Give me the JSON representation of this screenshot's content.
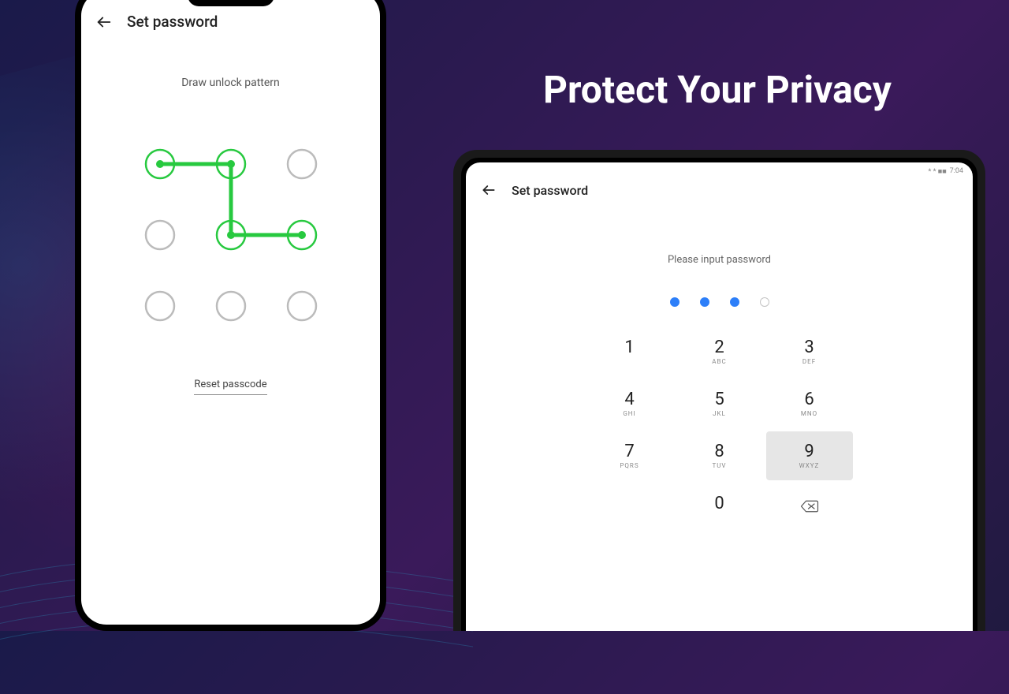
{
  "headline": "Protect Your Privacy",
  "phone": {
    "header": {
      "title": "Set password"
    },
    "prompt": "Draw  unlock  pattern",
    "reset_label": "Reset passcode",
    "pattern": {
      "active_dots": [
        0,
        1,
        4,
        5
      ],
      "path": [
        [
          0,
          0
        ],
        [
          1,
          0
        ],
        [
          1,
          1
        ],
        [
          2,
          1
        ]
      ]
    }
  },
  "tablet": {
    "status": {
      "time": "7:04",
      "icons": "*  *  ■■"
    },
    "header": {
      "title": "Set password"
    },
    "prompt": "Please input password",
    "pin": {
      "length": 4,
      "entered": 3
    },
    "keypad": [
      {
        "digit": "1",
        "letters": ""
      },
      {
        "digit": "2",
        "letters": "ABC"
      },
      {
        "digit": "3",
        "letters": "DEF"
      },
      {
        "digit": "4",
        "letters": "GHI"
      },
      {
        "digit": "5",
        "letters": "JKL"
      },
      {
        "digit": "6",
        "letters": "MNO"
      },
      {
        "digit": "7",
        "letters": "PQRS"
      },
      {
        "digit": "8",
        "letters": "TUV"
      },
      {
        "digit": "9",
        "letters": "WXYZ",
        "pressed": true
      },
      {
        "spacer": true
      },
      {
        "digit": "0",
        "letters": ""
      },
      {
        "action": "backspace"
      }
    ]
  }
}
